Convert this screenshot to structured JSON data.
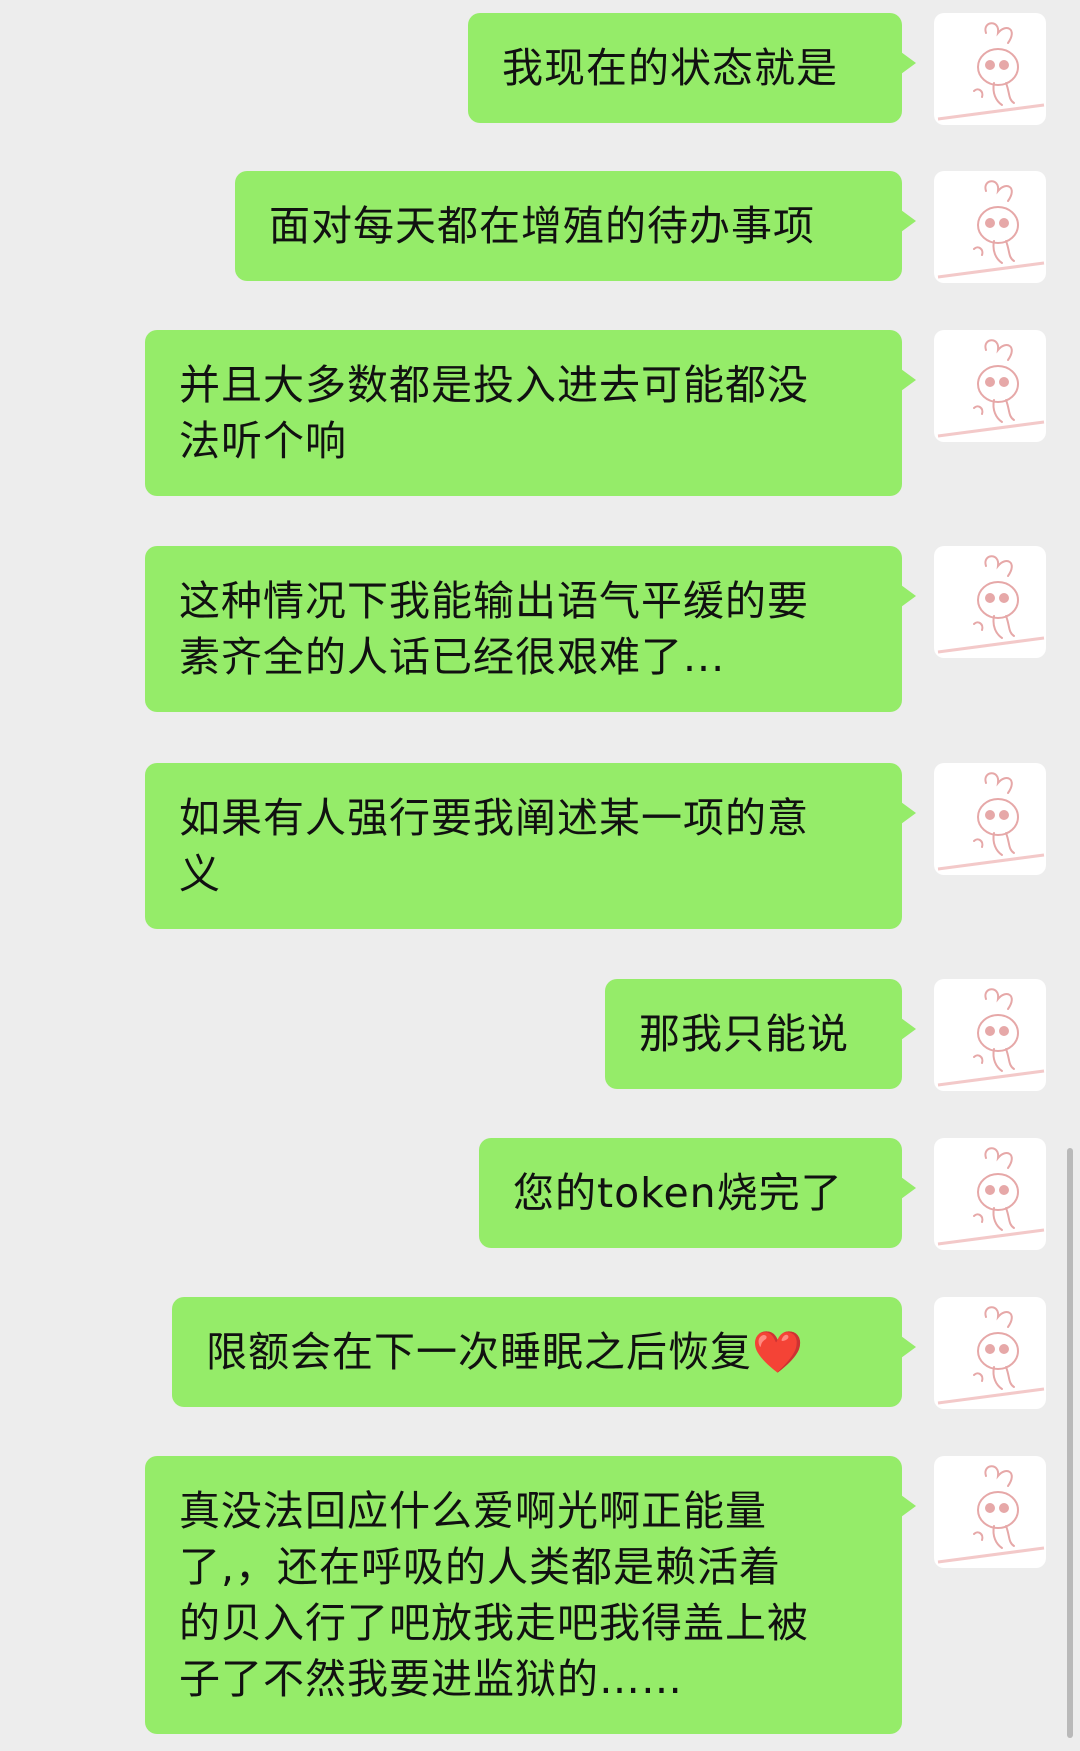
{
  "chat": {
    "messages": [
      {
        "text": "我现在的状态就是"
      },
      {
        "text": "面对每天都在增殖的待办事项"
      },
      {
        "text": "并且大多数都是投入进去可能都没\n法听个响"
      },
      {
        "text": "这种情况下我能输出语气平缓的要\n素齐全的人话已经很艰难了..."
      },
      {
        "text": "如果有人强行要我阐述某一项的意\n义"
      },
      {
        "text": "那我只能说"
      },
      {
        "text": "您的token烧完了"
      },
      {
        "text": "限额会在下一次睡眠之后恢复❤️"
      },
      {
        "text": "真没法回应什么爱啊光啊正能量\n了,，还在呼吸的人类都是赖活着\n的贝入行了吧放我走吧我得盖上被\n子了不然我要进监狱的……"
      }
    ],
    "bubble_color": "#95ec69",
    "background_color": "#ededed",
    "avatar_icon": "bunny-sketch-icon"
  }
}
